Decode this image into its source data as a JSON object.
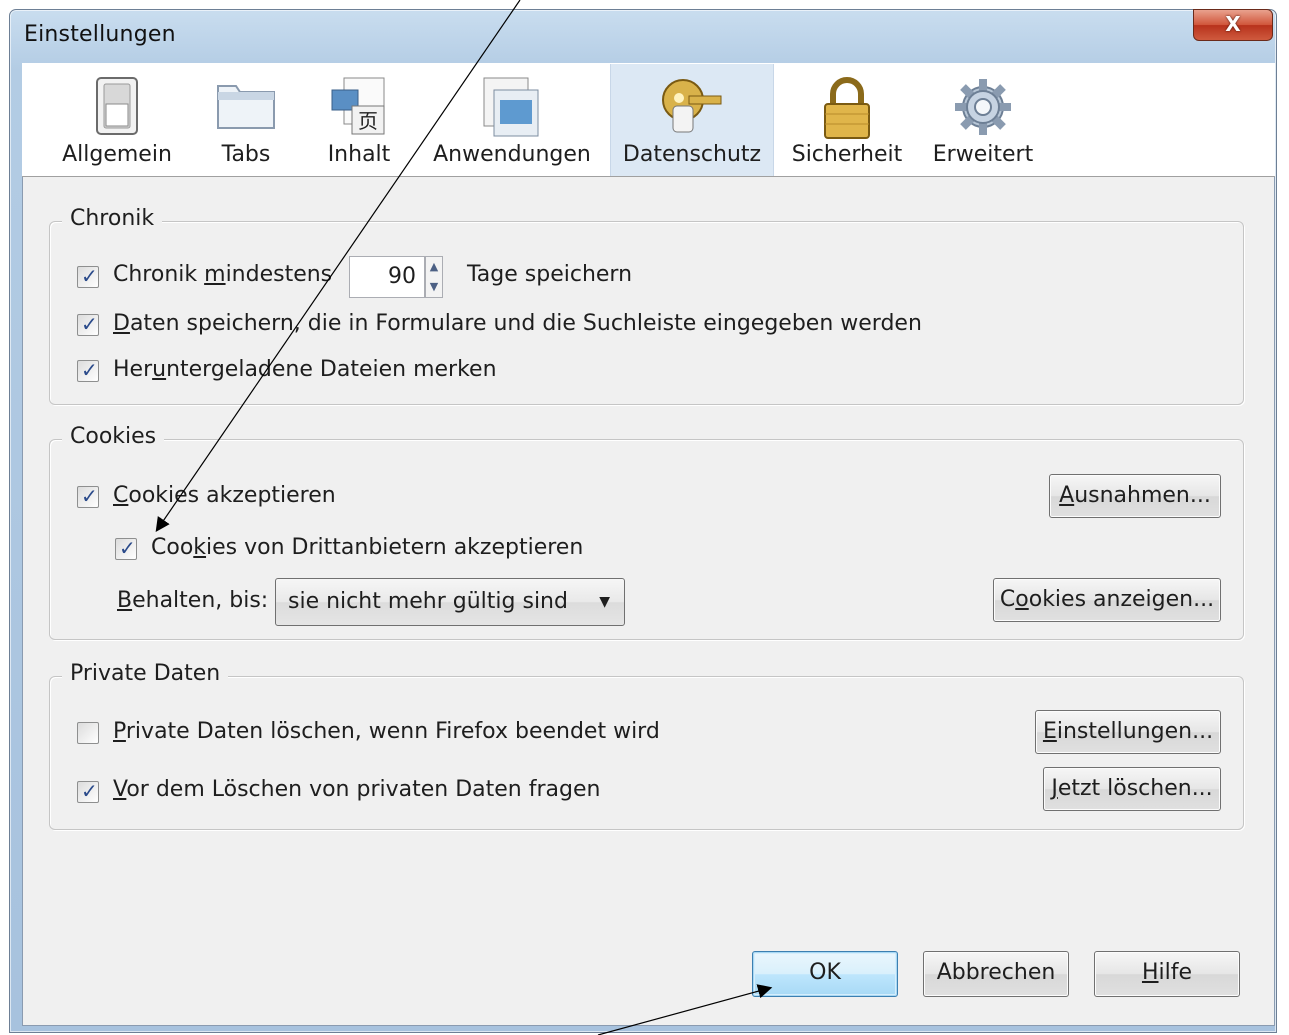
{
  "window": {
    "title": "Einstellungen",
    "close_label": "X"
  },
  "toolbar": {
    "panes": [
      {
        "label": "Allgemein",
        "icon": "switch-icon"
      },
      {
        "label": "Tabs",
        "icon": "tabs-icon"
      },
      {
        "label": "Inhalt",
        "icon": "content-icon"
      },
      {
        "label": "Anwendungen",
        "icon": "applications-icon"
      },
      {
        "label": "Datenschutz",
        "icon": "privacy-mask-icon",
        "selected": true
      },
      {
        "label": "Sicherheit",
        "icon": "padlock-icon"
      },
      {
        "label": "Erweitert",
        "icon": "gear-icon"
      }
    ]
  },
  "history": {
    "legend": "Chronik",
    "remember_label_pre": "Chronik ",
    "remember_label_ul": "m",
    "remember_label_post": "indestens",
    "days_value": "90",
    "days_suffix": "Tage speichern",
    "form_label_ul": "D",
    "form_label_post": "aten speichern, die in Formulare und die Suchleiste eingegeben werden",
    "downloads_label_pre": "Her",
    "downloads_label_ul": "u",
    "downloads_label_post": "ntergeladene Dateien merken"
  },
  "cookies": {
    "legend": "Cookies",
    "accept_ul": "C",
    "accept_post": "ookies akzeptieren",
    "third_party_pre": "Coo",
    "third_party_ul": "k",
    "third_party_post": "ies von Drittanbietern akzeptieren",
    "keep_label_ul": "B",
    "keep_label_post": "ehalten, bis:",
    "keep_value": "sie nicht mehr gültig sind",
    "exceptions_ul": "A",
    "exceptions_post": "usnahmen...",
    "show_pre": "C",
    "show_ul": "o",
    "show_post": "okies anzeigen..."
  },
  "private": {
    "legend": "Private Daten",
    "clear_ul": "P",
    "clear_post": "rivate Daten löschen, wenn Firefox beendet wird",
    "ask_ul": "V",
    "ask_post": "or dem Löschen von privaten Daten fragen",
    "settings_ul": "E",
    "settings_post": "instellungen...",
    "clear_now_ul": "J",
    "clear_now_post": "etzt löschen..."
  },
  "footer": {
    "ok": "OK",
    "cancel": "Abbrechen",
    "help_ul": "H",
    "help_post": "ilfe"
  },
  "checks": {
    "remember_history": true,
    "save_forms": true,
    "remember_downloads": true,
    "accept_cookies": true,
    "accept_third_party": true,
    "clear_on_exit": false,
    "ask_before_clear": true
  }
}
